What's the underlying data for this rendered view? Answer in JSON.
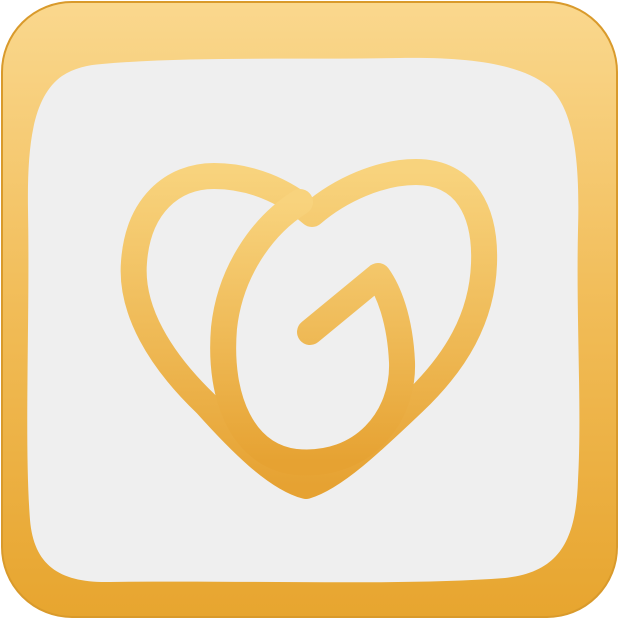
{
  "icon": {
    "name": "heart-loop-logo-icon",
    "style": "hand-drawn app tile",
    "colors": {
      "frame_light": "#FAD88E",
      "frame_mid": "#F1BC57",
      "frame_dark": "#E7A52F",
      "frame_edge": "#D99A2B",
      "inner_panel": "#EFEFEF",
      "glyph_light": "#F8D37D",
      "glyph_dark": "#E6A232"
    }
  }
}
